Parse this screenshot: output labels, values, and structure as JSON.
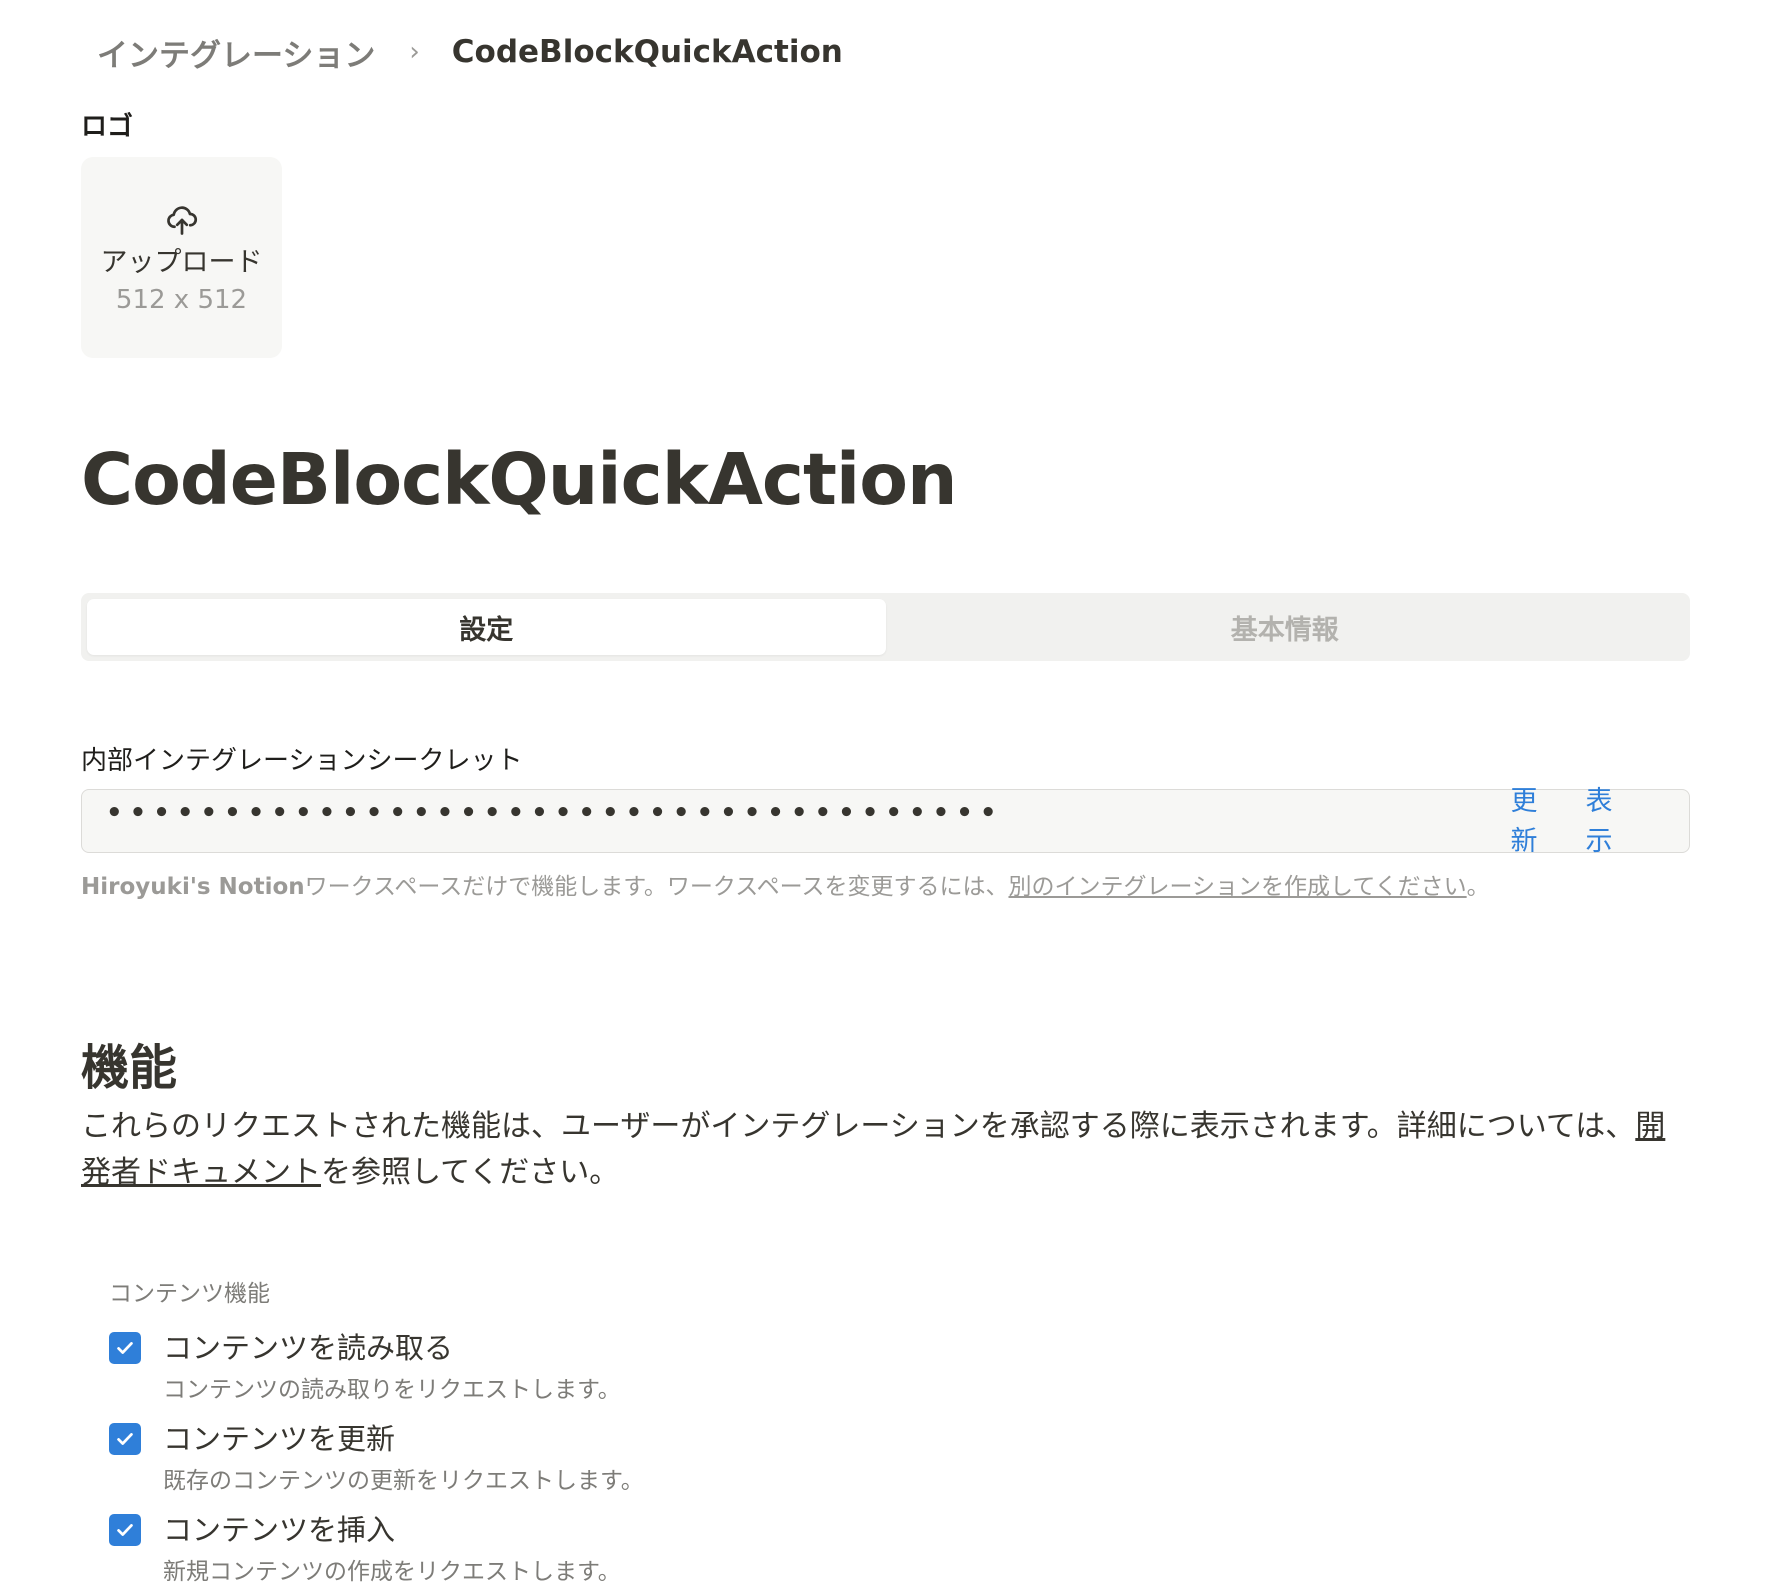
{
  "breadcrumb": {
    "parent": "インテグレーション",
    "separator": "›",
    "current": "CodeBlockQuickAction"
  },
  "logo": {
    "label": "ロゴ",
    "upload_label": "アップロード",
    "size_hint": "512 x 512",
    "icon": "cloud-upload-icon"
  },
  "page_title": "CodeBlockQuickAction",
  "tabs": [
    {
      "label": "設定",
      "active": true
    },
    {
      "label": "基本情報",
      "active": false
    }
  ],
  "secret": {
    "label": "内部インテグレーションシークレット",
    "masked_value": "••••••••••••••••••••••••••••••••••••••",
    "refresh_label": "更新",
    "show_label": "表示"
  },
  "helper": {
    "workspace": "Hiroyuki's Notion",
    "text": "ワークスペースだけで機能します。ワークスペースを変更するには、",
    "link": "別のインテグレーションを作成してください",
    "end": "。"
  },
  "capabilities": {
    "title": "機能",
    "description": "これらのリクエストされた機能は、ユーザーがインテグレーションを承認する際に表示されます。詳細については、",
    "doc_link": "開発者ドキュメント",
    "description_end": "を参照してください。",
    "group_label": "コンテンツ機能",
    "items": [
      {
        "title": "コンテンツを読み取る",
        "desc": "コンテンツの読み取りをリクエストします。",
        "checked": true
      },
      {
        "title": "コンテンツを更新",
        "desc": "既存のコンテンツの更新をリクエストします。",
        "checked": true
      },
      {
        "title": "コンテンツを挿入",
        "desc": "新規コンテンツの作成をリクエストします。",
        "checked": true
      }
    ]
  },
  "colors": {
    "accent": "#2f7fd9",
    "text": "#37352f",
    "muted": "#9b9a97",
    "field_bg": "#f7f7f5"
  }
}
